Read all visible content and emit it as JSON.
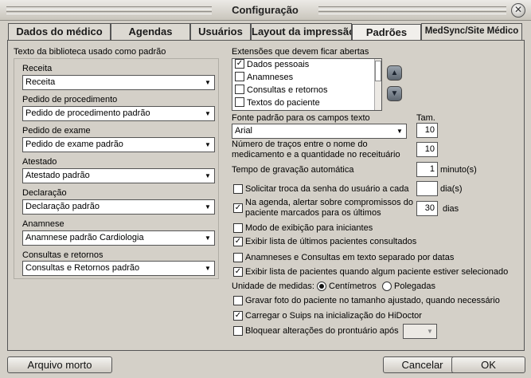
{
  "window": {
    "title": "Configuração"
  },
  "tabs": [
    "Dados do médico",
    "Agendas",
    "Usuários",
    "Layout da impressão",
    "Padrões",
    "MedSync/Site Médico"
  ],
  "left": {
    "section_title": "Texto da biblioteca usado como padrão",
    "fields": [
      {
        "label": "Receita",
        "value": "Receita"
      },
      {
        "label": "Pedido de procedimento",
        "value": "Pedido de procedimento padrão"
      },
      {
        "label": "Pedido de exame",
        "value": "Pedido de exame padrão"
      },
      {
        "label": "Atestado",
        "value": "Atestado padrão"
      },
      {
        "label": "Declaração",
        "value": "Declaração padrão"
      },
      {
        "label": "Anamnese",
        "value": "Anamnese padrão Cardiologia"
      },
      {
        "label": "Consultas e retornos",
        "value": "Consultas e Retornos padrão"
      }
    ]
  },
  "right": {
    "extensions_label": "Extensões que devem ficar abertas",
    "extensions": [
      {
        "label": "Dados pessoais",
        "checked": true
      },
      {
        "label": "Anamneses",
        "checked": false
      },
      {
        "label": "Consultas e retornos",
        "checked": false
      },
      {
        "label": "Textos do paciente",
        "checked": false
      }
    ],
    "font_label": "Fonte padrão para os campos texto",
    "font_value": "Arial",
    "size_label": "Tam.",
    "size_value": "10",
    "dashes_label_1": "Número de traços entre o nome do",
    "dashes_label_2": "medicamento e a quantidade no receituário",
    "dashes_value": "10",
    "autosave_label": "Tempo de gravação automática",
    "autosave_value": "1",
    "autosave_unit": "minuto(s)",
    "password": {
      "label": "Solicitar troca da senha do usuário a cada",
      "value": "",
      "unit": "dia(s)",
      "checked": false
    },
    "alert": {
      "label_1": "Na agenda, alertar sobre compromissos do",
      "label_2": "paciente marcados para os últimos",
      "value": "30",
      "unit": "dias",
      "checked": true
    },
    "options": [
      {
        "label": "Modo de exibição para iniciantes",
        "checked": false
      },
      {
        "label": "Exibir lista de últimos pacientes consultados",
        "checked": true
      },
      {
        "label": "Anamneses e Consultas em texto separado por datas",
        "checked": false
      },
      {
        "label": "Exibir lista de pacientes quando algum paciente estiver selecionado",
        "checked": true
      }
    ],
    "units": {
      "label": "Unidade de medidas:",
      "option_1": "Centímetros",
      "option_2": "Polegadas",
      "selected": "Centímetros"
    },
    "options2": [
      {
        "label": "Gravar foto do paciente no tamanho ajustado, quando necessário",
        "checked": false
      },
      {
        "label": "Carregar o Suips na inicialização do HiDoctor",
        "checked": true
      }
    ],
    "lock": {
      "label": "Bloquear alterações do prontuário após",
      "value": "",
      "checked": false
    }
  },
  "footer": {
    "archive": "Arquivo morto",
    "cancel": "Cancelar",
    "ok": "OK"
  }
}
